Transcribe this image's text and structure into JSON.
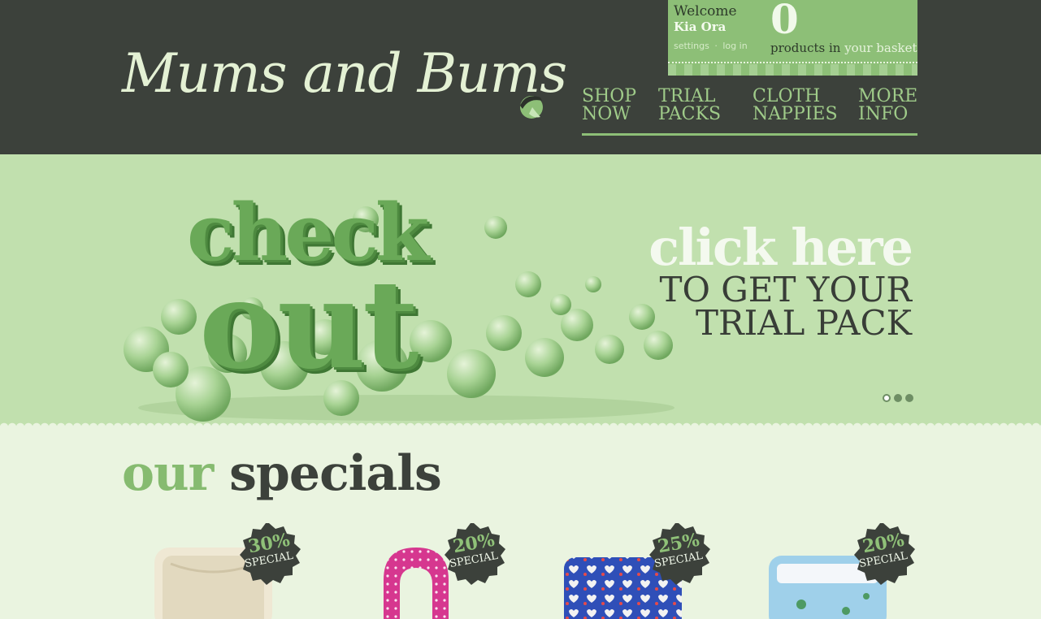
{
  "site": {
    "logo_text": "Mums and Bums"
  },
  "account": {
    "welcome": "Welcome",
    "username": "Kia Ora",
    "links": [
      "settings",
      "·",
      "log in"
    ],
    "basket_count": "0",
    "basket_text": "products in",
    "basket_link": "your basket"
  },
  "nav": [
    {
      "line1": "SHOP",
      "line2": "NOW"
    },
    {
      "line1": "TRIAL",
      "line2": "PACKS"
    },
    {
      "line1": "CLOTH",
      "line2": "NAPPIES"
    },
    {
      "line1": "MORE",
      "line2": "INFO"
    }
  ],
  "hero": {
    "art_word1": "check",
    "art_word2": "out",
    "cta_big": "click here",
    "cta_line1": "TO GET YOUR",
    "cta_line2": "TRIAL PACK",
    "slides_total": 3,
    "slide_active": 1
  },
  "specials": {
    "title_part1": "our",
    "title_part2": "specials",
    "items": [
      {
        "percent": "30%",
        "label": "SPECIAL",
        "image": "cream-cloth-nappy"
      },
      {
        "percent": "20%",
        "label": "SPECIAL",
        "image": "pink-polka-dot-bib"
      },
      {
        "percent": "25%",
        "label": "SPECIAL",
        "image": "blue-heart-print-nappy"
      },
      {
        "percent": "20%",
        "label": "SPECIAL",
        "image": "light-blue-dino-nappy"
      }
    ]
  },
  "colors": {
    "header_bg": "#3c413b",
    "accent_green": "#8dbf77",
    "hero_bg": "#c1e0ae",
    "page_bg": "#eaf4e0"
  }
}
